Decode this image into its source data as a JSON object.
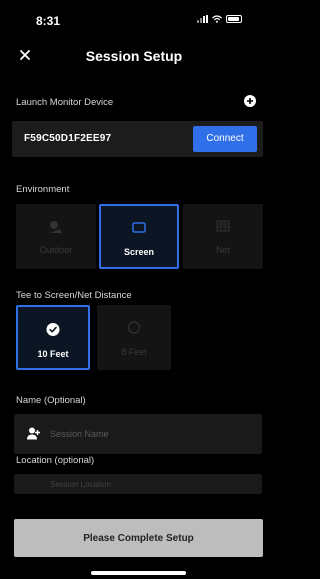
{
  "status_bar": {
    "time": "8:31"
  },
  "header": {
    "title": "Session Setup"
  },
  "launch_monitor": {
    "label": "Launch Monitor Device",
    "device_id": "F59C50D1F2EE97",
    "connect_label": "Connect"
  },
  "environment": {
    "label": "Environment",
    "options": [
      {
        "label": "Outdoor",
        "state": "disabled",
        "icon": "golf-ball-icon"
      },
      {
        "label": "Screen",
        "state": "selected",
        "icon": "screen-icon"
      },
      {
        "label": "Net",
        "state": "disabled",
        "icon": "net-icon"
      }
    ]
  },
  "distance": {
    "label": "Tee to Screen/Net Distance",
    "options": [
      {
        "label": "10 Feet",
        "state": "selected",
        "icon": "check-circle-icon"
      },
      {
        "label": "8 Feet",
        "state": "disabled",
        "icon": "circle-icon"
      }
    ]
  },
  "name": {
    "label": "Name (Optional)",
    "placeholder": "Session Name"
  },
  "location": {
    "label": "Location (optional)",
    "placeholder": "Session Location"
  },
  "footer": {
    "button_label": "Please Complete Setup"
  },
  "colors": {
    "accent": "#2f6fe8",
    "background": "#000000",
    "field": "#1a1a1a",
    "button_disabled": "#bdbdbd"
  }
}
